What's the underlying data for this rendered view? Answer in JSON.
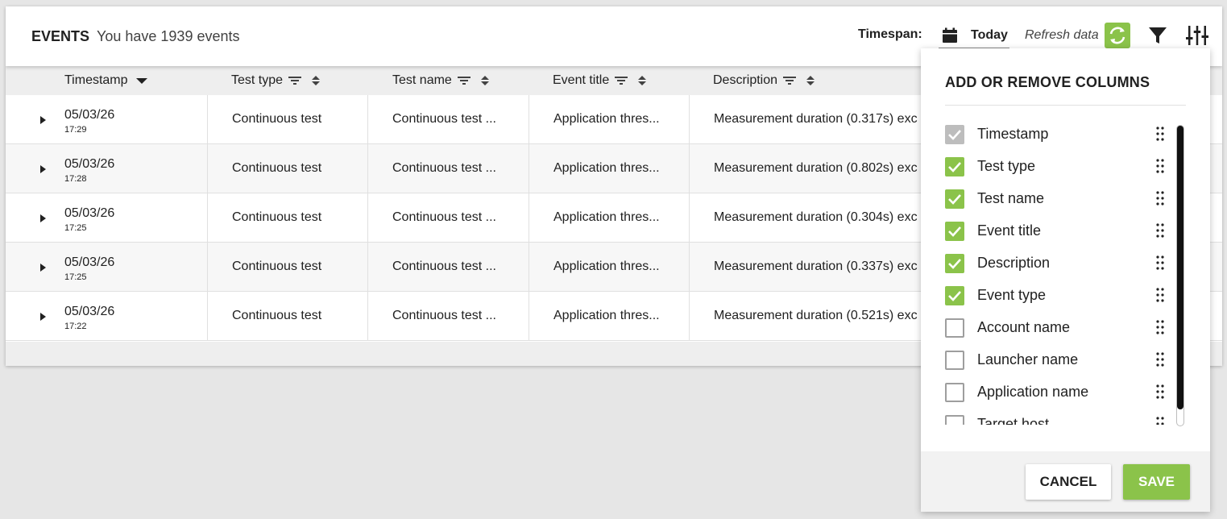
{
  "header": {
    "title": "EVENTS",
    "subtitle": "You have 1939 events",
    "timespan_label": "Timespan:",
    "timespan_value": "Today",
    "refresh_label": "Refresh data"
  },
  "table": {
    "columns": [
      {
        "label": "Timestamp",
        "icon": "sort-desc-arrow"
      },
      {
        "label": "Test type",
        "icon": "filter-lines"
      },
      {
        "label": "Test name",
        "icon": "filter-lines"
      },
      {
        "label": "Event title",
        "icon": "filter-lines"
      },
      {
        "label": "Description",
        "icon": "filter-lines"
      }
    ],
    "rows": [
      {
        "date": "05/03/26",
        "time": "17:29",
        "test_type": "Continuous test",
        "test_name": "Continuous test ...",
        "event_title": "Application thres...",
        "description": "Measurement duration (0.317s) exc"
      },
      {
        "date": "05/03/26",
        "time": "17:28",
        "test_type": "Continuous test",
        "test_name": "Continuous test ...",
        "event_title": "Application thres...",
        "description": "Measurement duration (0.802s) exc"
      },
      {
        "date": "05/03/26",
        "time": "17:25",
        "test_type": "Continuous test",
        "test_name": "Continuous test ...",
        "event_title": "Application thres...",
        "description": "Measurement duration (0.304s) exc"
      },
      {
        "date": "05/03/26",
        "time": "17:25",
        "test_type": "Continuous test",
        "test_name": "Continuous test ...",
        "event_title": "Application thres...",
        "description": "Measurement duration (0.337s) exc"
      },
      {
        "date": "05/03/26",
        "time": "17:22",
        "test_type": "Continuous test",
        "test_name": "Continuous test ...",
        "event_title": "Application thres...",
        "description": "Measurement duration (0.521s) exc"
      }
    ]
  },
  "columns_panel": {
    "title": "ADD OR REMOVE COLUMNS",
    "items": [
      {
        "label": "Timestamp",
        "state": "disabled-checked"
      },
      {
        "label": "Test type",
        "state": "checked"
      },
      {
        "label": "Test name",
        "state": "checked"
      },
      {
        "label": "Event title",
        "state": "checked"
      },
      {
        "label": "Description",
        "state": "checked"
      },
      {
        "label": "Event type",
        "state": "checked"
      },
      {
        "label": "Account name",
        "state": "unchecked"
      },
      {
        "label": "Launcher name",
        "state": "unchecked"
      },
      {
        "label": "Application name",
        "state": "unchecked"
      },
      {
        "label": "Target host",
        "state": "unchecked"
      }
    ],
    "cancel_label": "CANCEL",
    "save_label": "SAVE"
  },
  "colors": {
    "accent": "#8bc34a",
    "header_bg": "#eeeeee",
    "page_bg": "#e6e6e6"
  }
}
